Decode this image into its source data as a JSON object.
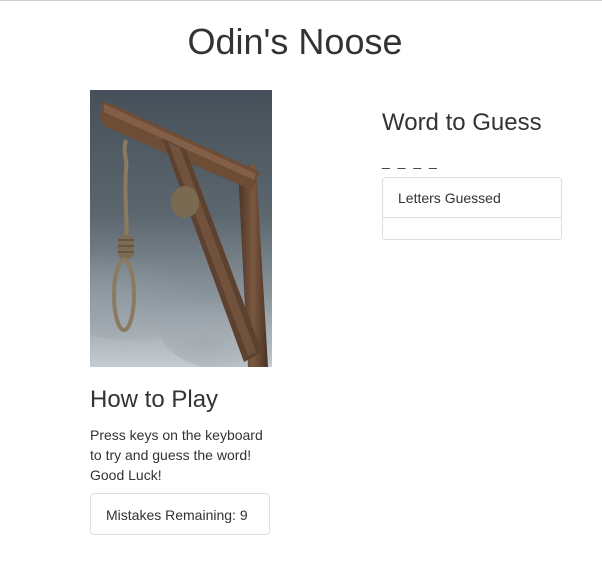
{
  "header": {
    "title": "Odin's Noose"
  },
  "image": {
    "subject": "gallows-with-noose",
    "sky_colors": [
      "#4a5258",
      "#6b747a",
      "#b9c2c7"
    ],
    "wood_color": "#6a4a35"
  },
  "how_to_play": {
    "heading": "How to Play",
    "text": "Press keys on the keyboard to try and guess the word! Good Luck!"
  },
  "mistakes": {
    "label": "Mistakes Remaining: 9"
  },
  "word": {
    "heading": "Word to Guess",
    "blanks": "_ _ _ _"
  },
  "letters_guessed": {
    "heading": "Letters Guessed",
    "value": ""
  },
  "colors": {
    "text": "#333333",
    "panel_border": "#dddddd",
    "top_rule": "#cfcfcf"
  }
}
